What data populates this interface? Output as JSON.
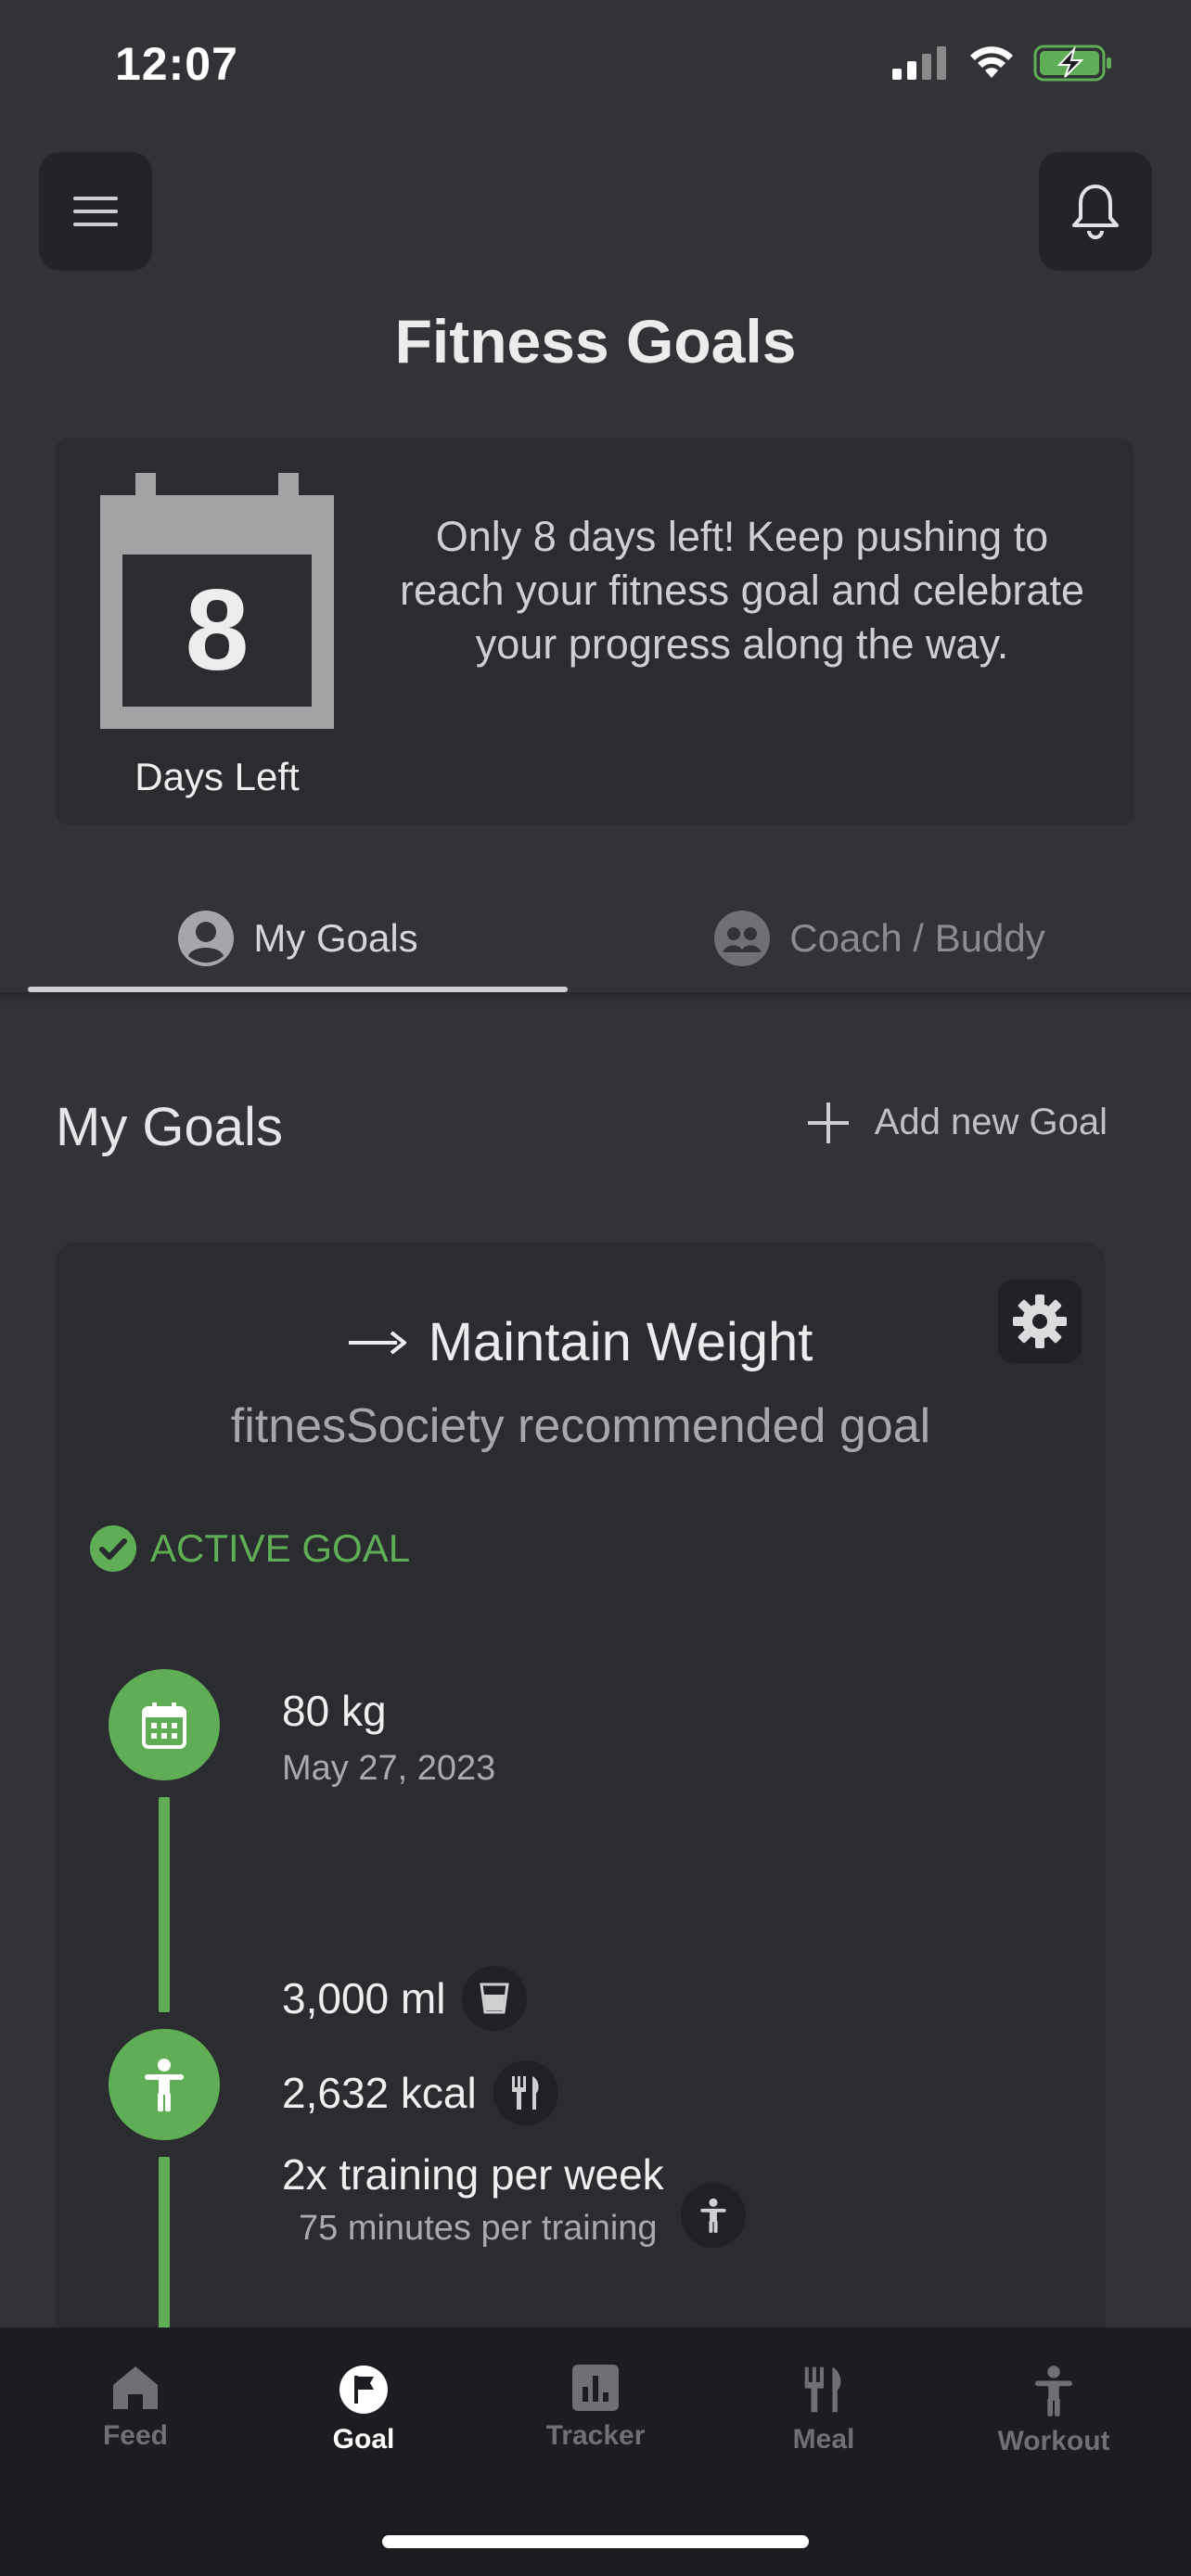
{
  "status_bar": {
    "time": "12:07"
  },
  "header": {
    "title": "Fitness Goals"
  },
  "countdown": {
    "days": "8",
    "days_label": "Days Left",
    "message": "Only 8 days left! Keep pushing to reach your fitness goal and celebrate your progress along the way."
  },
  "tabs": [
    {
      "label": "My Goals",
      "icon": "user-circle-icon",
      "active": true
    },
    {
      "label": "Coach / Buddy",
      "icon": "group-icon",
      "active": false
    }
  ],
  "section": {
    "title": "My Goals",
    "add_label": "Add new Goal"
  },
  "goal": {
    "title": "Maintain Weight",
    "subtitle": "fitnesSociety recommended goal",
    "status": "ACTIVE GOAL",
    "timeline": [
      {
        "main": "80 kg",
        "sub": "May 27, 2023"
      }
    ],
    "targets": {
      "water": "3,000 ml",
      "calories": "2,632 kcal",
      "training": "2x training per week",
      "training_sub": "75 minutes per training"
    }
  },
  "nav": [
    {
      "label": "Feed",
      "icon": "home-icon"
    },
    {
      "label": "Goal",
      "icon": "flag-icon"
    },
    {
      "label": "Tracker",
      "icon": "bar-chart-icon"
    },
    {
      "label": "Meal",
      "icon": "utensils-icon"
    },
    {
      "label": "Workout",
      "icon": "person-icon"
    }
  ],
  "colors": {
    "accent_green": "#5fae56",
    "background": "#323337",
    "card": "#2b2c30"
  }
}
